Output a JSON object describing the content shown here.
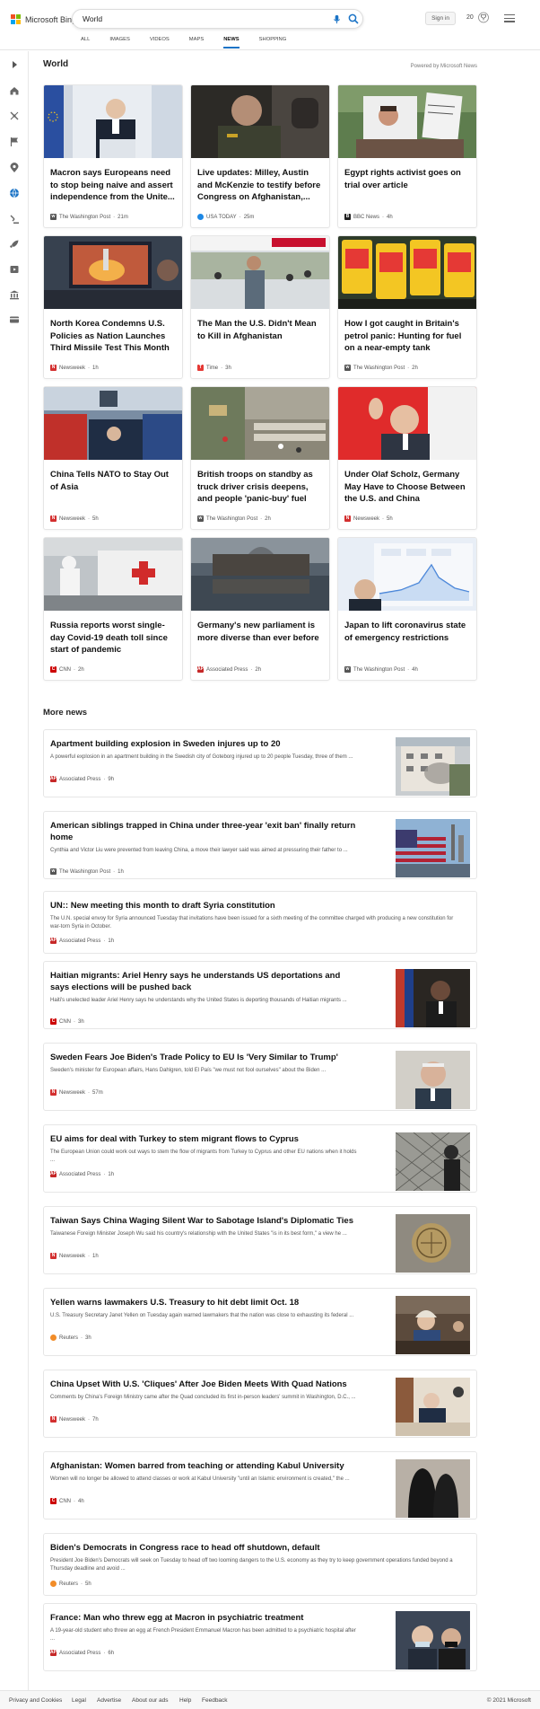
{
  "header": {
    "logo_text": "Microsoft Bing",
    "search_value": "World",
    "signin_label": "Sign in",
    "points": "20",
    "tabs": [
      {
        "label": "ALL"
      },
      {
        "label": "IMAGES"
      },
      {
        "label": "VIDEOS"
      },
      {
        "label": "MAPS"
      },
      {
        "label": "NEWS"
      },
      {
        "label": "SHOPPING"
      }
    ],
    "active_tab": "NEWS"
  },
  "rail": {
    "icons": [
      "expand-icon",
      "home-icon",
      "science-icon",
      "flag-icon",
      "location-icon",
      "globe-icon",
      "politics-icon",
      "rocket-icon",
      "entertainment-icon",
      "bank-icon",
      "card-icon"
    ]
  },
  "world": {
    "title": "World",
    "powered_by": "Powered by Microsoft News",
    "cards": [
      {
        "title": "Macron says Europeans need to stop being naive and assert independence from the Unite...",
        "source": "The Washington Post",
        "age": "21m",
        "icon": "wp",
        "color": "#555"
      },
      {
        "title": "Live updates: Milley, Austin and McKenzie to testify before Congress on Afghanistan,...",
        "source": "USA TODAY",
        "age": "25m",
        "icon": "usa",
        "color": "#1e88e5"
      },
      {
        "title": "Egypt rights activist goes on trial over article",
        "source": "BBC News",
        "age": "4h",
        "icon": "bbc",
        "color": "#222"
      },
      {
        "title": "North Korea Condemns U.S. Policies as Nation Launches Third Missile Test This Month",
        "source": "Newsweek",
        "age": "1h",
        "icon": "N",
        "color": "#d32f2f"
      },
      {
        "title": "The Man the U.S. Didn't Mean to Kill in Afghanistan",
        "source": "Time",
        "age": "3h",
        "icon": "T",
        "color": "#e53935"
      },
      {
        "title": "How I got caught in Britain's petrol panic: Hunting for fuel on a near-empty tank",
        "source": "The Washington Post",
        "age": "2h",
        "icon": "wp",
        "color": "#555"
      },
      {
        "title": "China Tells NATO to Stay Out of Asia",
        "source": "Newsweek",
        "age": "5h",
        "icon": "N",
        "color": "#d32f2f"
      },
      {
        "title": "British troops on standby as truck driver crisis deepens, and people 'panic-buy' fuel",
        "source": "The Washington Post",
        "age": "2h",
        "icon": "wp",
        "color": "#555"
      },
      {
        "title": "Under Olaf Scholz, Germany May Have to Choose Between the U.S. and China",
        "source": "Newsweek",
        "age": "5h",
        "icon": "N",
        "color": "#d32f2f"
      },
      {
        "title": "Russia reports worst single-day Covid-19 death toll since start of pandemic",
        "source": "CNN",
        "age": "2h",
        "icon": "cnn",
        "color": "#cc0000"
      },
      {
        "title": "Germany's new parliament is more diverse than ever before",
        "source": "Associated Press",
        "age": "2h",
        "icon": "AP",
        "color": "#c62828"
      },
      {
        "title": "Japan to lift coronavirus state of emergency restrictions",
        "source": "The Washington Post",
        "age": "4h",
        "icon": "wp",
        "color": "#555"
      }
    ]
  },
  "more_news": {
    "title": "More news",
    "items": [
      {
        "title": "Apartment building explosion in Sweden injures up to 20",
        "snippet": "A powerful explosion in an apartment building in the Swedish city of Goteborg injured up to 20 people Tuesday, three of them ...",
        "source": "Associated Press",
        "age": "9h",
        "icon": "AP",
        "color": "#c62828"
      },
      {
        "title": "American siblings trapped in China under three-year 'exit ban' finally return home",
        "snippet": "Cynthia and Victor Liu were prevented from leaving China, a move their lawyer said was aimed at pressuring their father to ...",
        "source": "The Washington Post",
        "age": "1h",
        "icon": "wp",
        "color": "#555"
      },
      {
        "title": "UN:: New meeting this month to draft Syria constitution",
        "snippet": "The U.N. special envoy for Syria announced Tuesday that invitations have been issued for a sixth meeting of the committee charged with producing a new constitution for war-torn Syria in October.",
        "source": "Associated Press",
        "age": "1h",
        "icon": "AP",
        "color": "#c62828"
      },
      {
        "title": "Haitian migrants: Ariel Henry says he understands US deportations and says elections will be pushed back",
        "snippet": "Haiti's unelected leader Ariel Henry says he understands why the United States is deporting thousands of Haitian migrants ...",
        "source": "CNN",
        "age": "3h",
        "icon": "cnn",
        "color": "#cc0000"
      },
      {
        "title": "Sweden Fears Joe Biden's Trade Policy to EU Is 'Very Similar to Trump'",
        "snippet": "Sweden's minister for European affairs, Hans Dahlgren, told El País \"we must not fool ourselves\" about the Biden ...",
        "source": "Newsweek",
        "age": "57m",
        "icon": "N",
        "color": "#d32f2f"
      },
      {
        "title": "EU aims for deal with Turkey to stem migrant flows to Cyprus",
        "snippet": "The European Union could work out ways to stem the flow of migrants from Turkey to Cyprus and other EU nations when it holds ...",
        "source": "Associated Press",
        "age": "1h",
        "icon": "AP",
        "color": "#c62828"
      },
      {
        "title": "Taiwan Says China Waging Silent War to Sabotage Island's Diplomatic Ties",
        "snippet": "Taiwanese Foreign Minister Joseph Wu said his country's relationship with the United States \"is in its best form,\" a view he ...",
        "source": "Newsweek",
        "age": "1h",
        "icon": "N",
        "color": "#d32f2f"
      },
      {
        "title": "Yellen warns lawmakers U.S. Treasury to hit debt limit Oct. 18",
        "snippet": "U.S. Treasury Secretary Janet Yellen on Tuesday again warned lawmakers that the nation was close to exhausting its federal ...",
        "source": "Reuters",
        "age": "3h",
        "icon": "reuters",
        "color": "#f28c28"
      },
      {
        "title": "China Upset With U.S. 'Cliques' After Joe Biden Meets With Quad Nations",
        "snippet": "Comments by China's Foreign Ministry came after the Quad concluded its first in-person leaders' summit in Washington, D.C., ...",
        "source": "Newsweek",
        "age": "7h",
        "icon": "N",
        "color": "#d32f2f"
      },
      {
        "title": "Afghanistan: Women barred from teaching or attending Kabul University",
        "snippet": "Women will no longer be allowed to attend classes or work at Kabul University \"until an Islamic environment is created,\" the ...",
        "source": "CNN",
        "age": "4h",
        "icon": "cnn",
        "color": "#cc0000"
      },
      {
        "title": "Biden's Democrats in Congress race to head off shutdown, default",
        "snippet": "President Joe Biden's Democrats will seek on Tuesday to head off two looming dangers to the U.S. economy as they try to keep government operations funded beyond a Thursday deadline and avoid ...",
        "source": "Reuters",
        "age": "5h",
        "icon": "reuters",
        "color": "#f28c28"
      },
      {
        "title": "France: Man who threw egg at Macron in psychiatric treatment",
        "snippet": "A 19-year-old student who threw an egg at French President Emmanuel Macron has been admitted to a psychiatric hospital after ...",
        "source": "Associated Press",
        "age": "6h",
        "icon": "AP",
        "color": "#c62828"
      }
    ]
  },
  "footer": {
    "links": [
      {
        "label": "Privacy and Cookies"
      },
      {
        "label": "Legal"
      },
      {
        "label": "Advertise"
      },
      {
        "label": "About our ads"
      },
      {
        "label": "Help"
      },
      {
        "label": "Feedback"
      }
    ],
    "copyright": "© 2021 Microsoft"
  }
}
